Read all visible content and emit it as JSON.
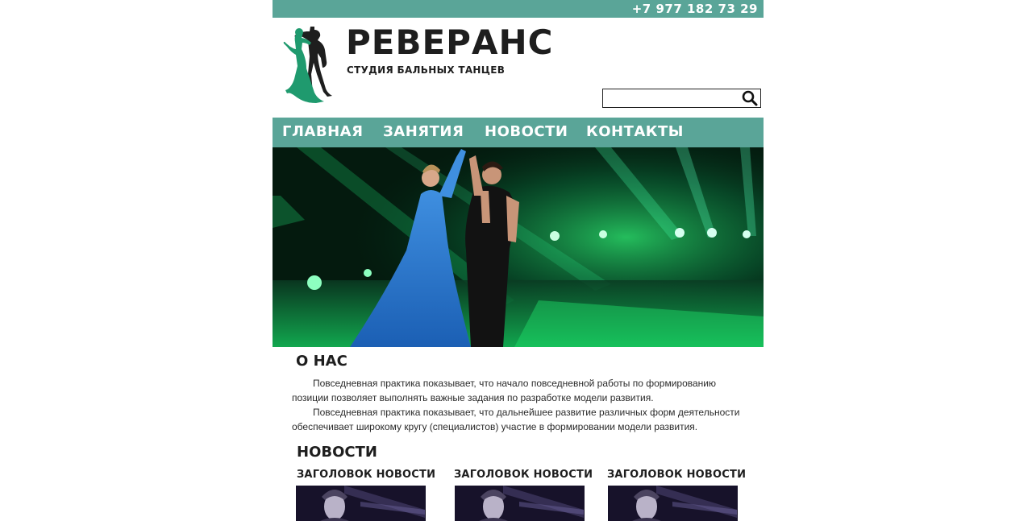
{
  "colors": {
    "accent": "#5aa598",
    "text": "#1e1e1e",
    "logo_dress": "#1f9a6e",
    "logo_partner": "#1e1e1e"
  },
  "topbar": {
    "phone": "+7 977 182 73 29"
  },
  "header": {
    "logo_icon": "dancing-couple-logo",
    "title": "РЕВЕРАНС",
    "subtitle": "СТУДИЯ БАЛЬНЫХ ТАНЦЕВ"
  },
  "search": {
    "value": "",
    "placeholder": "",
    "icon": "search-icon"
  },
  "nav": {
    "items": [
      {
        "label": "ГЛАВНАЯ"
      },
      {
        "label": "ЗАНЯТИЯ"
      },
      {
        "label": "НОВОСТИ"
      },
      {
        "label": "КОНТАКТЫ"
      }
    ]
  },
  "hero": {
    "image": "ballroom-dancers-photo"
  },
  "about": {
    "title": "О НАС",
    "paragraphs": [
      "Повседневная практика показывает, что начало повседневной работы по формированию позиции позволяет выполнять важные задания по разработке модели развития.",
      "Повседневная практика показывает, что дальнейшее развитие различных форм деятельности обеспечивает широкому кругу (специалистов) участие в формировании модели развития."
    ]
  },
  "news": {
    "title": "НОВОСТИ",
    "items": [
      {
        "title": "ЗАГОЛОВОК НОВОСТИ",
        "image": "news-photo"
      },
      {
        "title": "ЗАГОЛОВОК НОВОСТИ",
        "image": "news-photo"
      },
      {
        "title": "ЗАГОЛОВОК НОВОСТИ",
        "image": "news-photo"
      }
    ]
  }
}
